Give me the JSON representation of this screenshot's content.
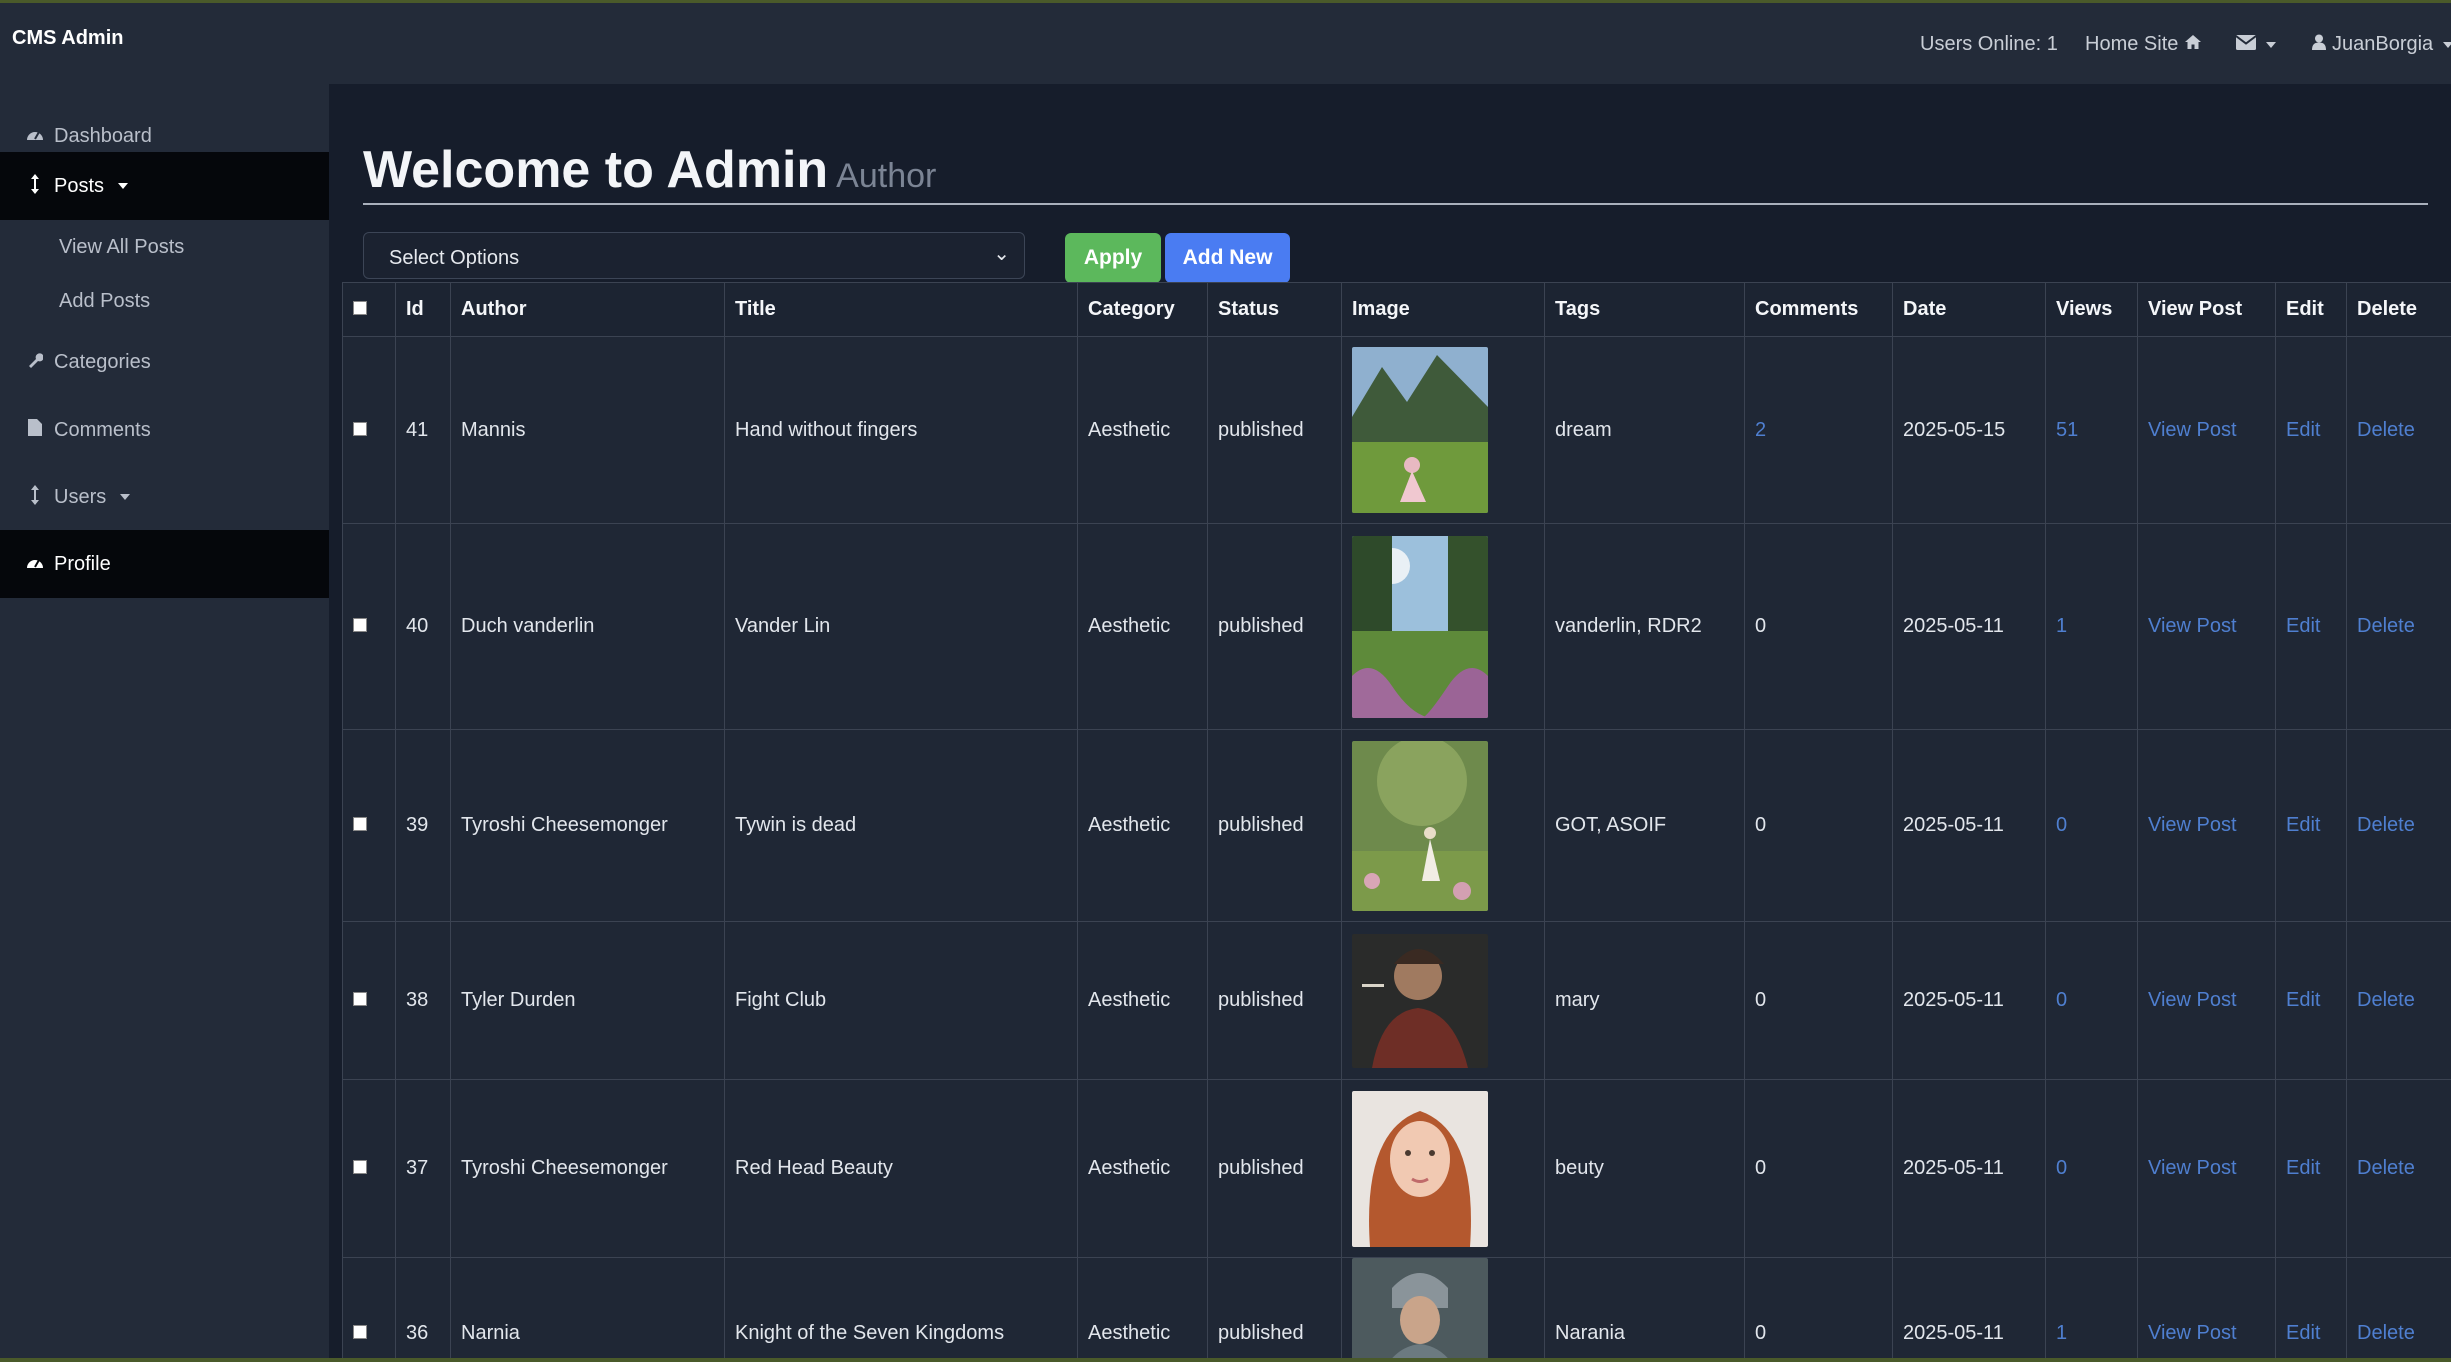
{
  "brand": "CMS Admin",
  "nav": {
    "users_online": "Users Online: 1",
    "home_site": "Home Site",
    "user": "JuanBorgia"
  },
  "sidebar": {
    "dashboard": "Dashboard",
    "posts": "Posts",
    "view_all_posts": "View All Posts",
    "add_posts": "Add Posts",
    "categories": "Categories",
    "comments": "Comments",
    "users": "Users",
    "profile": "Profile"
  },
  "page": {
    "title": "Welcome to Admin",
    "subtitle": "Author"
  },
  "bulk": {
    "select_placeholder": "Select Options",
    "apply": "Apply",
    "add_new": "Add New"
  },
  "table": {
    "headers": [
      "Id",
      "Author",
      "Title",
      "Category",
      "Status",
      "Image",
      "Tags",
      "Comments",
      "Date",
      "Views",
      "View Post",
      "Edit",
      "Delete"
    ],
    "rows": [
      {
        "id": "41",
        "author": "Mannis",
        "title": "Hand without fingers",
        "category": "Aesthetic",
        "status": "published",
        "image": "woman-in-field-mountains",
        "tags": "dream",
        "comments": "2",
        "date": "2025-05-15",
        "views": "51",
        "view_post": "View Post",
        "edit": "Edit",
        "delete": "Delete"
      },
      {
        "id": "40",
        "author": "Duch vanderlin",
        "title": "Vander Lin",
        "category": "Aesthetic",
        "status": "published",
        "image": "meadow-with-flowers",
        "tags": "vanderlin, RDR2",
        "comments": "0",
        "date": "2025-05-11",
        "views": "1",
        "view_post": "View Post",
        "edit": "Edit",
        "delete": "Delete"
      },
      {
        "id": "39",
        "author": "Tyroshi Cheesemonger",
        "title": "Tywin is dead",
        "category": "Aesthetic",
        "status": "published",
        "image": "girl-in-forest",
        "tags": "GOT, ASOIF",
        "comments": "0",
        "date": "2025-05-11",
        "views": "0",
        "view_post": "View Post",
        "edit": "Edit",
        "delete": "Delete"
      },
      {
        "id": "38",
        "author": "Tyler Durden",
        "title": "Fight Club",
        "category": "Aesthetic",
        "status": "published",
        "image": "man-smoking-portrait",
        "tags": "mary",
        "comments": "0",
        "date": "2025-05-11",
        "views": "0",
        "view_post": "View Post",
        "edit": "Edit",
        "delete": "Delete"
      },
      {
        "id": "37",
        "author": "Tyroshi Cheesemonger",
        "title": "Red Head Beauty",
        "category": "Aesthetic",
        "status": "published",
        "image": "red-haired-woman-portrait",
        "tags": "beuty",
        "comments": "0",
        "date": "2025-05-11",
        "views": "0",
        "view_post": "View Post",
        "edit": "Edit",
        "delete": "Delete"
      },
      {
        "id": "36",
        "author": "Narnia",
        "title": "Knight of the Seven Kingdoms",
        "category": "Aesthetic",
        "status": "published",
        "image": "knight-in-armor",
        "tags": "Narania",
        "comments": "0",
        "date": "2025-05-11",
        "views": "1",
        "view_post": "View Post",
        "edit": "Edit",
        "delete": "Delete"
      }
    ]
  }
}
